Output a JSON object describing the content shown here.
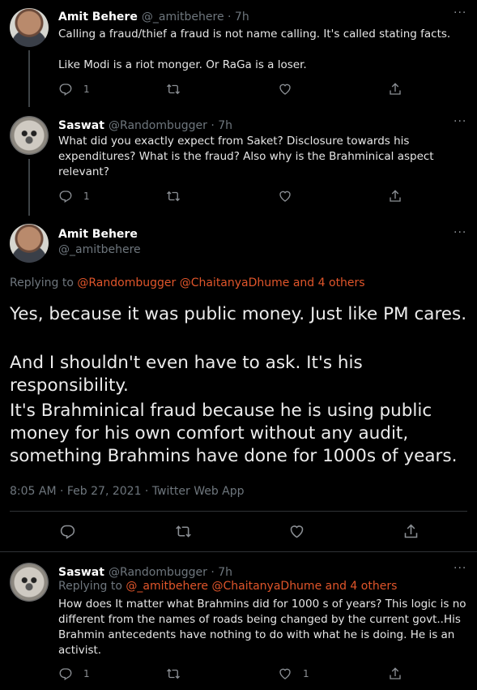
{
  "tweet1": {
    "name": "Amit Behere",
    "handle": "@_amitbehere · 7h",
    "text_line1": "Calling a fraud/thief a fraud is not name calling. It's called stating facts.",
    "text_line2": "Like Modi is a riot monger. Or RaGa is a loser.",
    "reply_count": "1"
  },
  "tweet2": {
    "name": "Saswat",
    "handle": "@Randombugger · 7h",
    "text": "What did you exactly expect from Saket? Disclosure towards his expenditures? What is the fraud?  Also why is the Brahminical aspect relevant?",
    "reply_count": "1"
  },
  "main_tweet": {
    "name": "Amit Behere",
    "handle": "@_amitbehere",
    "replying_prefix": "Replying to",
    "replying_mentions": "@Randombugger @ChaitanyaDhume and 4 others",
    "para1": "Yes, because it was public money. Just like PM cares.",
    "para2": "And I shouldn't even have to ask. It's his responsibility.",
    "para3": "It's Brahminical fraud because he is using public money for his own comfort without any audit, something Brahmins have done for 1000s of years.",
    "meta": "8:05 AM · Feb 27, 2021 · Twitter Web App"
  },
  "tweet4": {
    "name": "Saswat",
    "handle": "@Randombugger · 7h",
    "replying_prefix": "Replying to",
    "replying_mentions": "@_amitbehere @ChaitanyaDhume and 4 others",
    "text": "How does It matter what Brahmins did for 1000 s of years? This logic is no different from the names of roads being changed by the current govt..His Brahmin antecedents have nothing to do with what he is doing. He is an activist.",
    "reply_count": "1",
    "like_count": "1"
  },
  "more_glyph": "···",
  "icons": [
    "reply-icon",
    "retweet-icon",
    "like-icon",
    "share-icon",
    "more-icon"
  ],
  "colors": {
    "background": "#000000",
    "mention": "#e0552a",
    "muted": "#6e767d"
  }
}
